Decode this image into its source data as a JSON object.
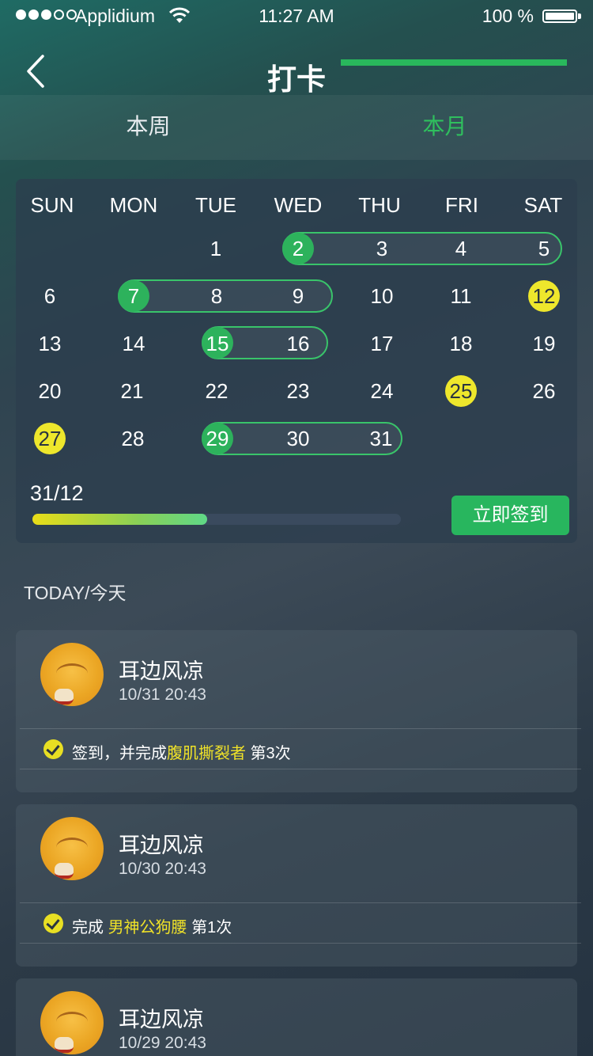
{
  "status_bar": {
    "carrier": "Applidium",
    "time": "11:27 AM",
    "battery": "100 %"
  },
  "nav": {
    "title": "打卡"
  },
  "tabs": [
    {
      "label": "本周"
    },
    {
      "label": "本月"
    }
  ],
  "calendar": {
    "weekdays": [
      "SUN",
      "MON",
      "TUE",
      "WED",
      "THU",
      "FRI",
      "SAT"
    ],
    "days": [
      "1",
      "2",
      "3",
      "4",
      "5",
      "6",
      "7",
      "8",
      "9",
      "10",
      "11",
      "12",
      "13",
      "14",
      "15",
      "16",
      "17",
      "18",
      "19",
      "20",
      "21",
      "22",
      "23",
      "24",
      "25",
      "26",
      "27",
      "28",
      "29",
      "30",
      "31"
    ],
    "streak_start_days": [
      "2",
      "7",
      "15",
      "29"
    ],
    "highlight_days": [
      "12",
      "25",
      "27"
    ],
    "colors": {
      "streak": "#2db25c",
      "highlight": "#eee72c"
    },
    "progress": {
      "label": "31/12",
      "fraction": 0.47
    },
    "checkin_button": "立即签到"
  },
  "feed": {
    "section_title": "TODAY/今天",
    "items": [
      {
        "name": "耳边风凉",
        "time": "10/31 20:43",
        "prefix": "签到，并完成",
        "highlight": "腹肌撕裂者",
        "suffix": " 第3次"
      },
      {
        "name": "耳边风凉",
        "time": "10/30 20:43",
        "prefix": "完成 ",
        "highlight": "男神公狗腰",
        "suffix": " 第1次"
      },
      {
        "name": "耳边风凉",
        "time": "10/29 20:43",
        "prefix": "",
        "highlight": "",
        "suffix": ""
      }
    ]
  }
}
